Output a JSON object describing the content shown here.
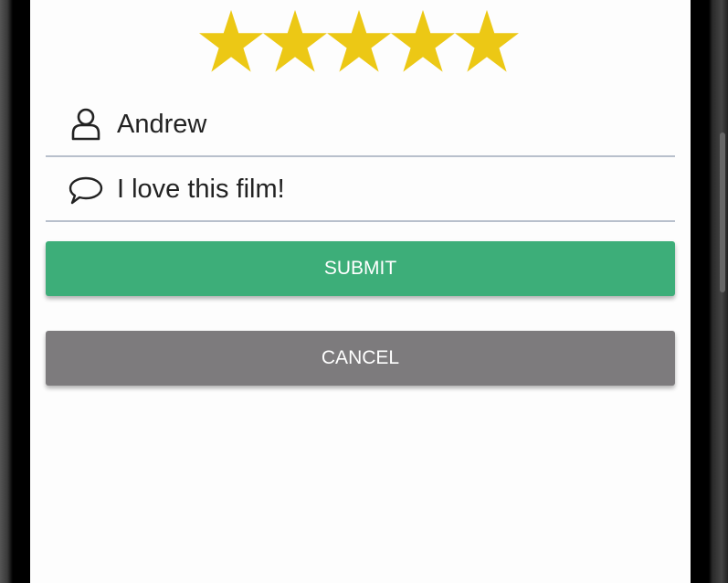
{
  "rating": {
    "value": 5,
    "max": 5,
    "color": "#ecc815"
  },
  "form": {
    "name_value": "Andrew",
    "comment_value": "I love this film!"
  },
  "buttons": {
    "submit_label": "SUBMIT",
    "submit_color": "#3dae79",
    "cancel_label": "CANCEL",
    "cancel_color": "#7d7b7d"
  }
}
